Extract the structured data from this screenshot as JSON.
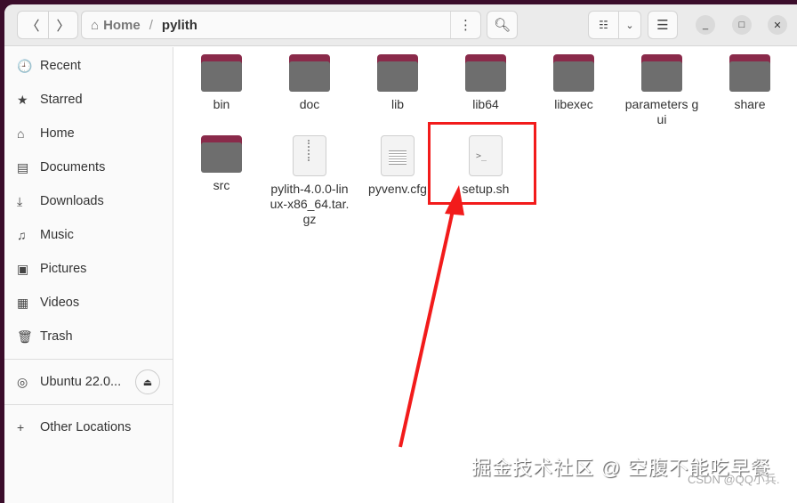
{
  "header": {
    "breadcrumb": [
      "Home",
      "pylith"
    ],
    "more_icon": "⋮",
    "search_icon": "search",
    "view_icon": "list",
    "menu_icon": "☰"
  },
  "sidebar": {
    "items": [
      {
        "icon": "🕘",
        "label": "Recent"
      },
      {
        "icon": "★",
        "label": "Starred"
      },
      {
        "icon": "⌂",
        "label": "Home"
      },
      {
        "icon": "▤",
        "label": "Documents"
      },
      {
        "icon": "⤓",
        "label": "Downloads"
      },
      {
        "icon": "♫",
        "label": "Music"
      },
      {
        "icon": "▣",
        "label": "Pictures"
      },
      {
        "icon": "▦",
        "label": "Videos"
      },
      {
        "icon": "🗑",
        "label": "Trash"
      }
    ],
    "drive": "Ubuntu 22.0...",
    "other": "Other Locations"
  },
  "files": [
    {
      "name": "bin",
      "type": "folder"
    },
    {
      "name": "doc",
      "type": "folder"
    },
    {
      "name": "lib",
      "type": "folder"
    },
    {
      "name": "lib64",
      "type": "folder"
    },
    {
      "name": "libexec",
      "type": "folder"
    },
    {
      "name": "parameters gui",
      "type": "folder"
    },
    {
      "name": "share",
      "type": "folder"
    },
    {
      "name": "src",
      "type": "folder"
    },
    {
      "name": "pylith-4.0.0-linux-x86_64.tar.gz",
      "type": "archive"
    },
    {
      "name": "pyvenv.cfg",
      "type": "text"
    },
    {
      "name": "setup.sh",
      "type": "script"
    }
  ],
  "watermark": {
    "main": "掘金技术社区 @ 空腹不能吃早餐",
    "csdn": "CSDN @QQ小兵."
  },
  "colors": {
    "highlight": "#f21b1b",
    "folder": "#6e6e6e",
    "folder_tab": "#8a2a4a"
  }
}
